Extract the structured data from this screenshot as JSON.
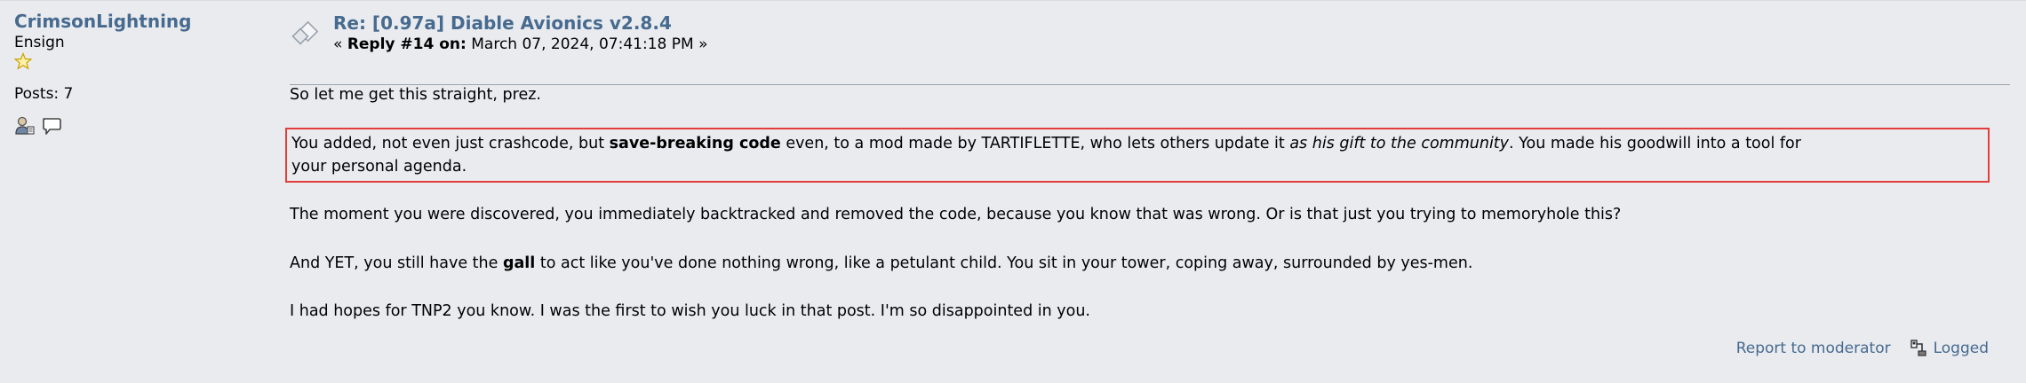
{
  "poster": {
    "name": "CrimsonLightning",
    "rank": "Ensign",
    "posts_label": "Posts: 7"
  },
  "post": {
    "subject": "Re: [0.97a] Diable Avionics v2.8.4",
    "reply_prefix": "«",
    "reply_label": "Reply #14 on:",
    "reply_date": "March 07, 2024, 07:41:18 PM",
    "reply_suffix": "»",
    "paragraphs": {
      "p1": "So let me get this straight, prez.",
      "p2_a": "You added, not even just crashcode, but ",
      "p2_b": "save-breaking code",
      "p2_c": " even, to a mod made by TARTIFLETTE, who lets others update it ",
      "p2_d": "as his gift to the community",
      "p2_e": ". You made his goodwill into a tool for",
      "p2_f": "your personal agenda.",
      "p3": "The moment you were discovered, you immediately backtracked and removed the code, because you know that was wrong. Or is that just you trying to memoryhole this?",
      "p4_a": "And YET, you still have the ",
      "p4_b": "gall",
      "p4_c": " to act like you've done nothing wrong, like a petulant child. You sit in your tower, coping away, surrounded by yes-men.",
      "p5": "I had hopes for TNP2 you know. I was the first to wish you luck in that post. I'm so disappointed in you."
    },
    "highlight_color": "#e43d3d"
  },
  "footer": {
    "report_label": "Report to moderator",
    "logged_label": "Logged"
  },
  "colors": {
    "link": "#476a8f",
    "background": "#e9ebef",
    "rank_star": "#e6b800"
  },
  "icons": [
    "star-icon",
    "profile-icon",
    "message-icon",
    "post-subject-icon",
    "logged-ip-icon"
  ]
}
